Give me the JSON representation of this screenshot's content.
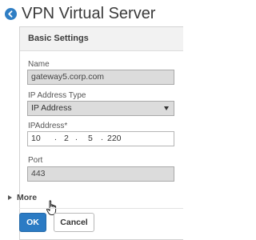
{
  "header": {
    "back_icon": "back-arrow-circle-icon",
    "title": "VPN Virtual Server"
  },
  "panel": {
    "title": "Basic Settings"
  },
  "form": {
    "name_label": "Name",
    "name_value": "gateway5.corp.com",
    "ip_type_label": "IP Address Type",
    "ip_type_value": "IP Address",
    "ip_label": "IPAddress*",
    "ip_octets": [
      "10",
      "2",
      "5",
      "220"
    ],
    "port_label": "Port",
    "port_value": "443",
    "more_label": "More"
  },
  "footer": {
    "ok_label": "OK",
    "cancel_label": "Cancel"
  },
  "colors": {
    "accent": "#2b7bc4",
    "readonly_field": "#dcdcdc",
    "panel_header": "#f2f2f2"
  }
}
